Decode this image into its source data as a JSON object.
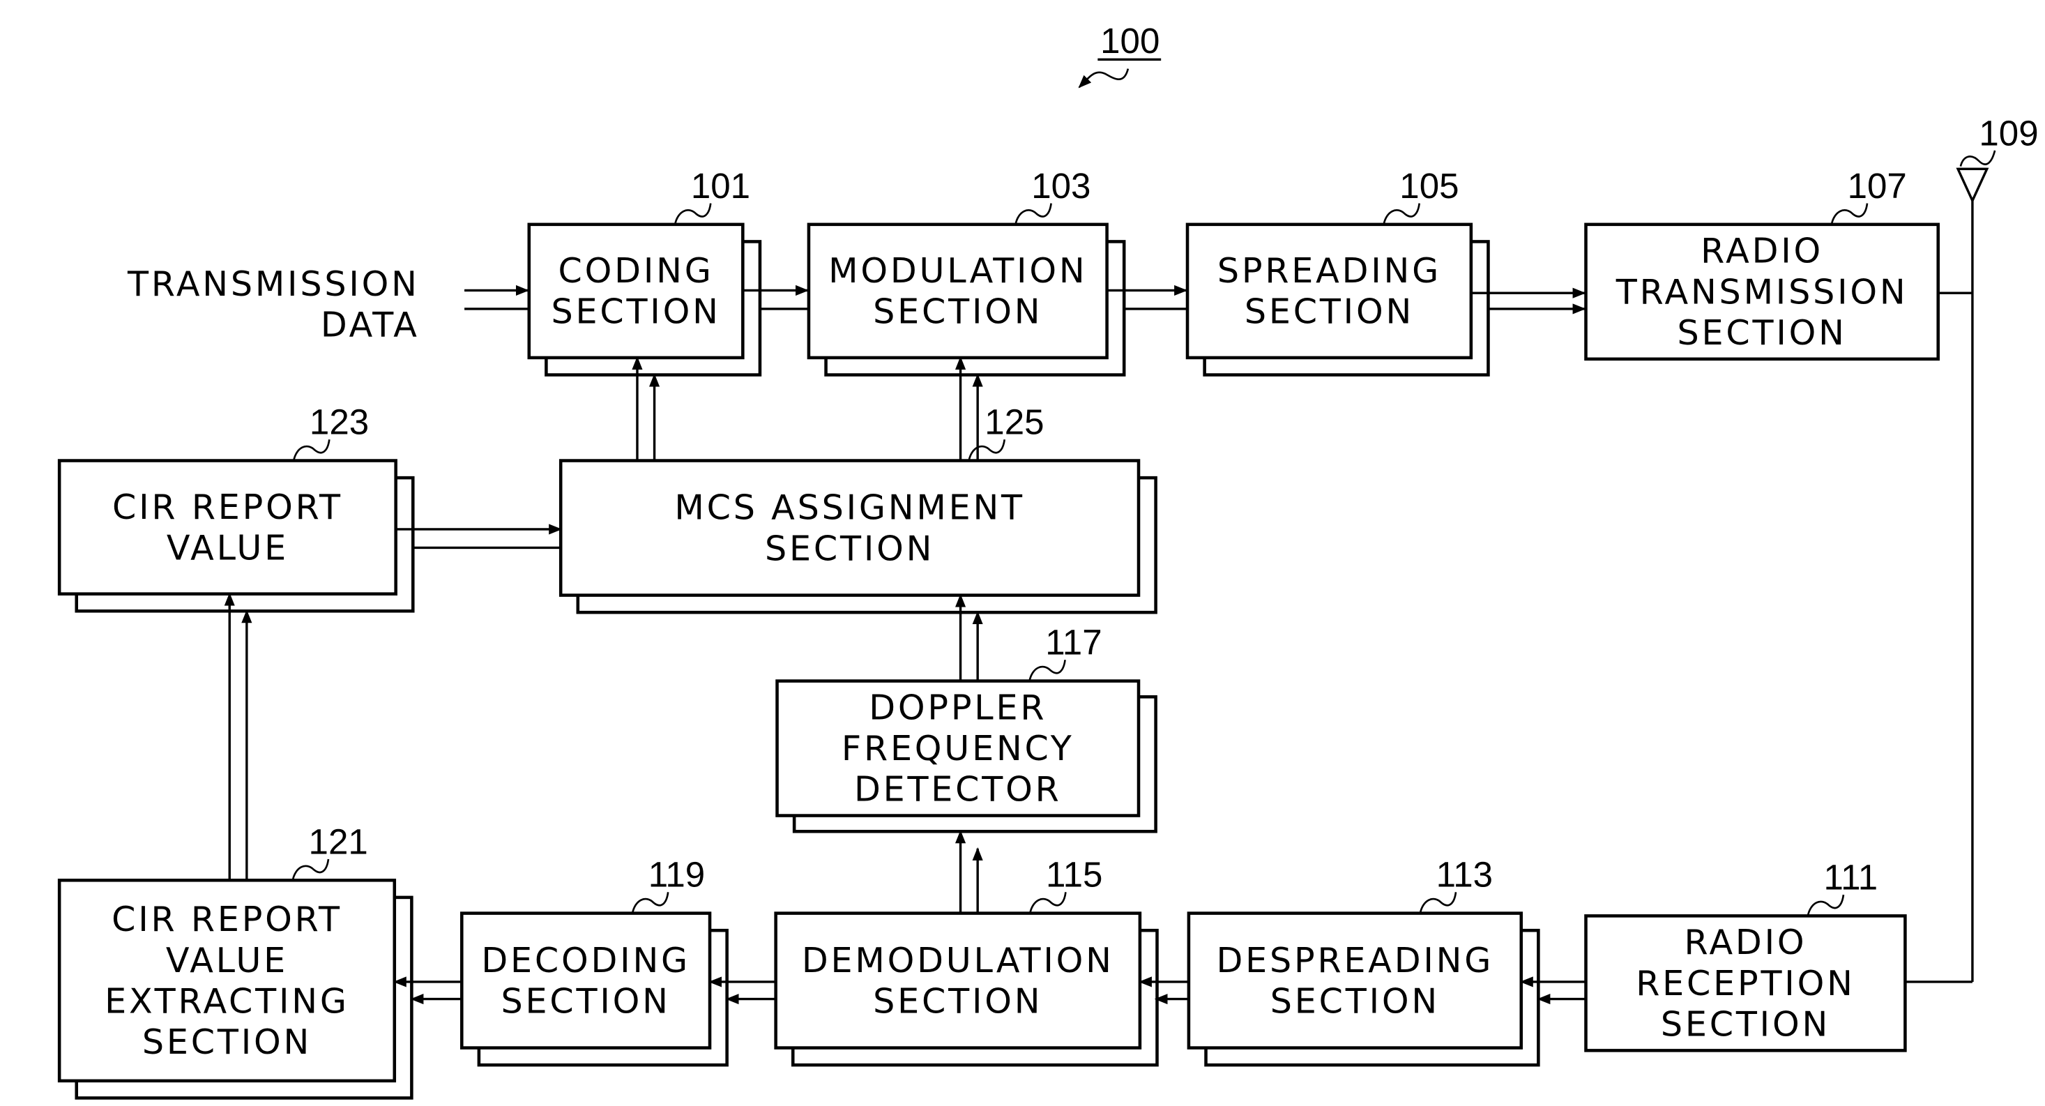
{
  "figure": {
    "reference": "100",
    "input_label": [
      "TRANSMISSION",
      "DATA"
    ],
    "antenna_ref": "109"
  },
  "blocks": {
    "coding": {
      "ref": "101",
      "lines": [
        "CODING",
        "SECTION"
      ]
    },
    "modulation": {
      "ref": "103",
      "lines": [
        "MODULATION",
        "SECTION"
      ]
    },
    "spreading": {
      "ref": "105",
      "lines": [
        "SPREADING",
        "SECTION"
      ]
    },
    "radio_tx": {
      "ref": "107",
      "lines": [
        "RADIO",
        "TRANSMISSION",
        "SECTION"
      ]
    },
    "radio_rx": {
      "ref": "111",
      "lines": [
        "RADIO",
        "RECEPTION",
        "SECTION"
      ]
    },
    "despreading": {
      "ref": "113",
      "lines": [
        "DESPREADING",
        "SECTION"
      ]
    },
    "demodulation": {
      "ref": "115",
      "lines": [
        "DEMODULATION",
        "SECTION"
      ]
    },
    "doppler": {
      "ref": "117",
      "lines": [
        "DOPPLER",
        "FREQUENCY",
        "DETECTOR"
      ]
    },
    "decoding": {
      "ref": "119",
      "lines": [
        "DECODING",
        "SECTION"
      ]
    },
    "cir_extract": {
      "ref": "121",
      "lines": [
        "CIR REPORT",
        "VALUE",
        "EXTRACTING",
        "SECTION"
      ]
    },
    "cir_value": {
      "ref": "123",
      "lines": [
        "CIR REPORT",
        "VALUE"
      ]
    },
    "mcs": {
      "ref": "125",
      "lines": [
        "MCS ASSIGNMENT",
        "SECTION"
      ]
    }
  }
}
